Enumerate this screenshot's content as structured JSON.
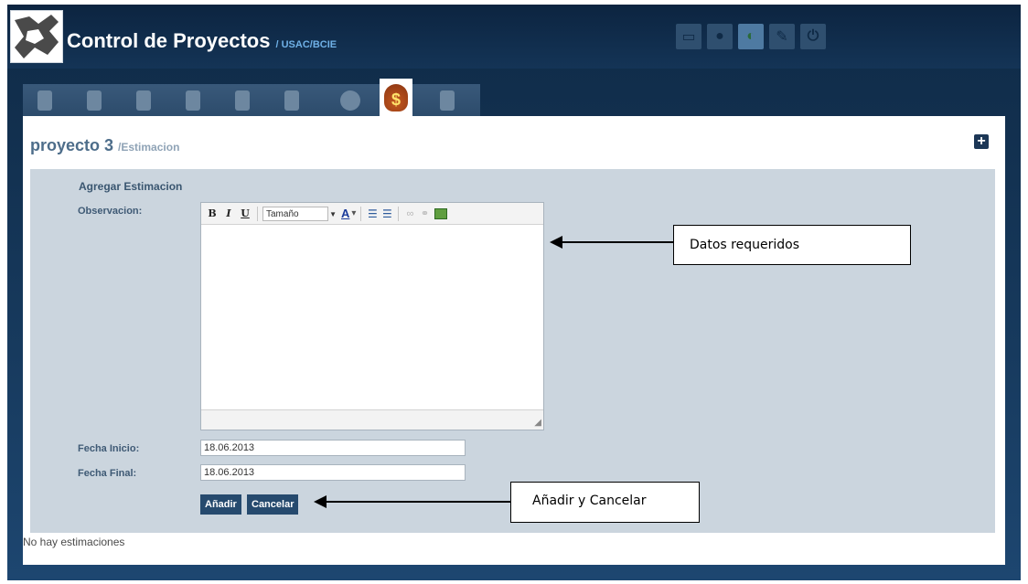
{
  "app": {
    "title": "Control de Proyectos",
    "subtitle": "/ USAC/BCIE"
  },
  "top_icons": [
    {
      "name": "monitor-icon",
      "glyph": "▭"
    },
    {
      "name": "user-icon",
      "glyph": "●"
    },
    {
      "name": "globe-icon",
      "glyph": "◐"
    },
    {
      "name": "wrench-icon",
      "glyph": "✎"
    },
    {
      "name": "power-icon",
      "glyph": "⏻"
    }
  ],
  "tabs": [
    {
      "name": "tab-network-icon"
    },
    {
      "name": "tab-calendar-icon"
    },
    {
      "name": "tab-checklist-icon"
    },
    {
      "name": "tab-edit-icon"
    },
    {
      "name": "tab-save-icon"
    },
    {
      "name": "tab-phonebook-icon"
    },
    {
      "name": "tab-clock-icon"
    },
    {
      "name": "tab-money-bag-icon",
      "active": true,
      "glyph": "$"
    },
    {
      "name": "tab-clipboard-icon"
    }
  ],
  "page": {
    "title": "proyecto 3",
    "subtitle": "/Estimacion",
    "add_glyph": "+"
  },
  "form": {
    "heading": "Agregar Estimacion",
    "observacion_label": "Observacion:",
    "toolbar": {
      "bold": "B",
      "italic": "I",
      "underline": "U",
      "size_placeholder": "Tamaño",
      "font_color": "A"
    },
    "fecha_inicio_label": "Fecha Inicio:",
    "fecha_inicio_value": "18.06.2013",
    "fecha_final_label": "Fecha Final:",
    "fecha_final_value": "18.06.2013",
    "add_button": "Añadir",
    "cancel_button": "Cancelar"
  },
  "empty_message": "No hay estimaciones",
  "annotations": {
    "datos_requeridos": "Datos requeridos",
    "anadir_cancelar": "Añadir y Cancelar"
  }
}
